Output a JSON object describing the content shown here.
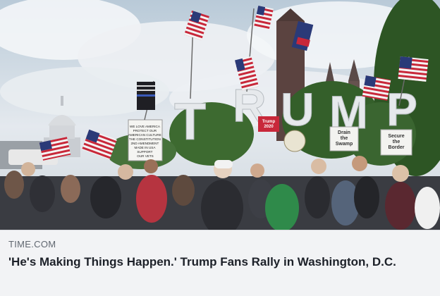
{
  "link_preview": {
    "domain": "TIME.COM",
    "headline": "'He's Making Things Happen.' Trump Fans Rally in Washington, D.C."
  },
  "photo": {
    "letters": [
      "T",
      "R",
      "U",
      "M",
      "P"
    ],
    "signs": {
      "left_sign": "WE LOVE AMERICA\nPROTECT OUR\nAMERICAN CULTURE\nTHE CONSTITUTION\n2ND AMENDMENT\nMADE IN USA\nSUPPORT\nOUR VETS",
      "trump_2020": "Trump\n2020",
      "drain": "Drain\nthe\nSwamp",
      "secure": "Secure\nthe\nBorder"
    }
  },
  "colors": {
    "sky": "#d8e2ea",
    "caption_bg": "#f2f3f5",
    "headline_text": "#1d2129",
    "domain_text": "#606770",
    "flag_red": "#c8283a",
    "flag_blue": "#2a3a78"
  }
}
